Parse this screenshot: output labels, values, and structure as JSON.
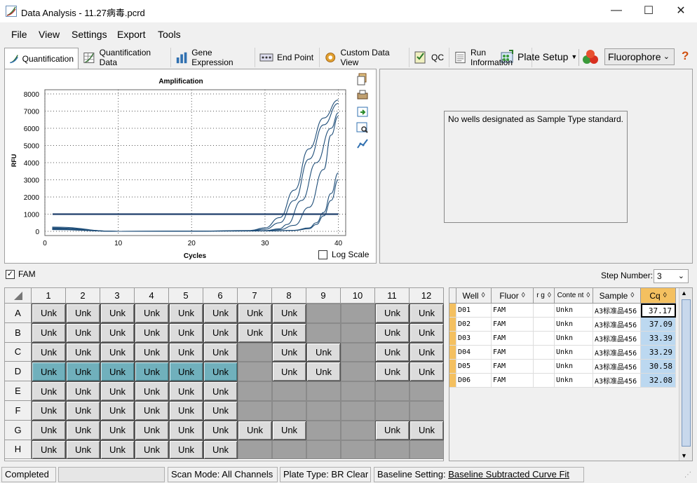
{
  "window": {
    "title": "Data Analysis - 11.27病毒.pcrd"
  },
  "menu": {
    "items": [
      "File",
      "View",
      "Settings",
      "Export",
      "Tools"
    ]
  },
  "toolbar": {
    "plate_setup": "Plate Setup",
    "fluorophore": "Fluorophore",
    "help": "?"
  },
  "tabs": [
    "Quantification",
    "Quantification Data",
    "Gene Expression",
    "End Point",
    "Custom Data View",
    "QC",
    "Run Information"
  ],
  "std_curve": {
    "message": "No wells designated as Sample Type standard."
  },
  "chart_data": {
    "type": "line",
    "title": "Amplification",
    "xlabel": "Cycles",
    "ylabel": "RFU",
    "xlim": [
      0,
      41
    ],
    "ylim": [
      0,
      8000
    ],
    "x_ticks": [
      0,
      10,
      20,
      30,
      40
    ],
    "y_ticks": [
      0,
      1000,
      2000,
      3000,
      4000,
      5000,
      6000,
      7000,
      8000
    ],
    "grid": true,
    "threshold": 1000,
    "series": [
      {
        "x": [
          1,
          10,
          20,
          28,
          30,
          32,
          34,
          36,
          38,
          40
        ],
        "y": [
          250,
          0,
          10,
          50,
          200,
          800,
          2400,
          4800,
          6600,
          7650
        ]
      },
      {
        "x": [
          1,
          10,
          20,
          28,
          30,
          32,
          34,
          36,
          38,
          40
        ],
        "y": [
          200,
          0,
          10,
          40,
          120,
          500,
          1800,
          4200,
          6200,
          7450
        ]
      },
      {
        "x": [
          1,
          10,
          20,
          30,
          32,
          33,
          35,
          37,
          39,
          40
        ],
        "y": [
          180,
          0,
          10,
          40,
          150,
          400,
          1800,
          4000,
          6000,
          6900
        ]
      },
      {
        "x": [
          1,
          10,
          20,
          30,
          32,
          34,
          36,
          38,
          39,
          40
        ],
        "y": [
          150,
          0,
          10,
          30,
          100,
          350,
          1400,
          3600,
          5600,
          6700
        ]
      },
      {
        "x": [
          1,
          10,
          20,
          30,
          34,
          36,
          37,
          38,
          39,
          40
        ],
        "y": [
          120,
          0,
          10,
          20,
          60,
          200,
          500,
          1100,
          2200,
          3400
        ]
      },
      {
        "x": [
          1,
          10,
          20,
          30,
          34,
          36,
          37,
          38,
          39,
          40
        ],
        "y": [
          100,
          0,
          10,
          20,
          50,
          150,
          400,
          900,
          1800,
          3000
        ]
      }
    ],
    "log_scale_label": "Log Scale",
    "log_scale_checked": false
  },
  "channel": {
    "label": "FAM",
    "checked": true
  },
  "step": {
    "label": "Step Number:",
    "value": "3"
  },
  "plate": {
    "columns": [
      "1",
      "2",
      "3",
      "4",
      "5",
      "6",
      "7",
      "8",
      "9",
      "10",
      "11",
      "12"
    ],
    "rows": [
      "A",
      "B",
      "C",
      "D",
      "E",
      "F",
      "G",
      "H"
    ],
    "well_label": "Unk",
    "wells": [
      [
        1,
        1,
        1,
        1,
        1,
        1,
        1,
        1,
        0,
        0,
        1,
        1
      ],
      [
        1,
        1,
        1,
        1,
        1,
        1,
        1,
        1,
        0,
        0,
        1,
        1
      ],
      [
        1,
        1,
        1,
        1,
        1,
        1,
        0,
        1,
        1,
        0,
        1,
        1
      ],
      [
        2,
        2,
        2,
        2,
        2,
        2,
        0,
        1,
        1,
        0,
        1,
        1
      ],
      [
        1,
        1,
        1,
        1,
        1,
        1,
        0,
        0,
        0,
        0,
        0,
        0
      ],
      [
        1,
        1,
        1,
        1,
        1,
        1,
        0,
        0,
        0,
        0,
        0,
        0
      ],
      [
        1,
        1,
        1,
        1,
        1,
        1,
        1,
        1,
        0,
        0,
        1,
        1
      ],
      [
        1,
        1,
        1,
        1,
        1,
        1,
        0,
        0,
        0,
        0,
        0,
        0
      ]
    ]
  },
  "results": {
    "headers": [
      "Well",
      "Fluor",
      "r g",
      "Conte nt",
      "Sample",
      "Cq"
    ],
    "rows": [
      [
        "D01",
        "FAM",
        "",
        "Unkn",
        "A3标准品456",
        "37.17"
      ],
      [
        "D02",
        "FAM",
        "",
        "Unkn",
        "A3标准品456",
        "37.09"
      ],
      [
        "D03",
        "FAM",
        "",
        "Unkn",
        "A3标准品456",
        "33.39"
      ],
      [
        "D04",
        "FAM",
        "",
        "Unkn",
        "A3标准品456",
        "33.29"
      ],
      [
        "D05",
        "FAM",
        "",
        "Unkn",
        "A3标准品456",
        "30.58"
      ],
      [
        "D06",
        "FAM",
        "",
        "Unkn",
        "A3标准品456",
        "32.08"
      ]
    ]
  },
  "status": {
    "state": "Completed",
    "scan_mode": "Scan Mode: All Channels",
    "plate_type": "Plate Type: BR Clear",
    "baseline_prefix": "Baseline Setting: ",
    "baseline_value": "Baseline Subtracted Curve Fit"
  },
  "colors": {
    "curve": "#1f4e79",
    "threshold": "#1f3f6a",
    "selected_well": "#70b0bc",
    "cq_cell": "#bcd8f0"
  }
}
